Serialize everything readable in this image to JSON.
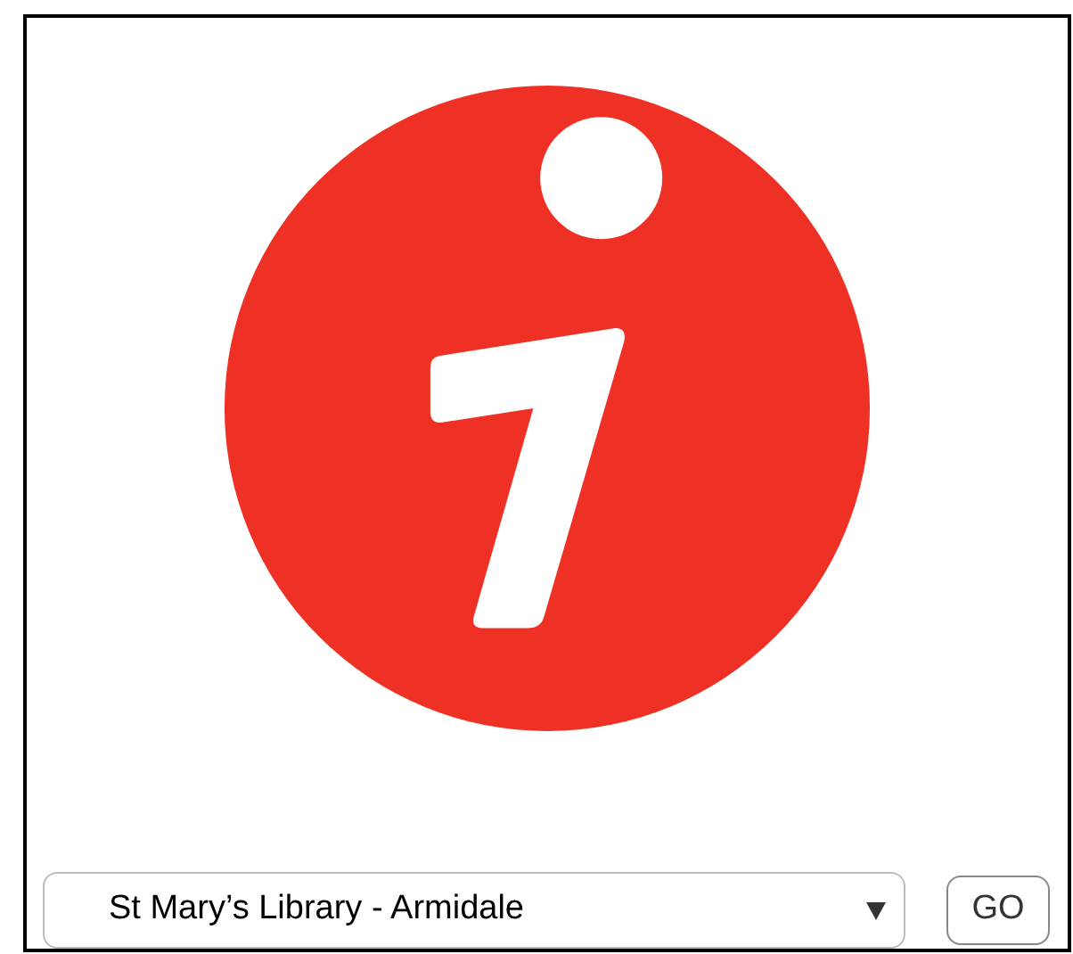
{
  "location_select": {
    "value": "St Mary’s Library - Armidale"
  },
  "go_button": {
    "label": "GO"
  }
}
